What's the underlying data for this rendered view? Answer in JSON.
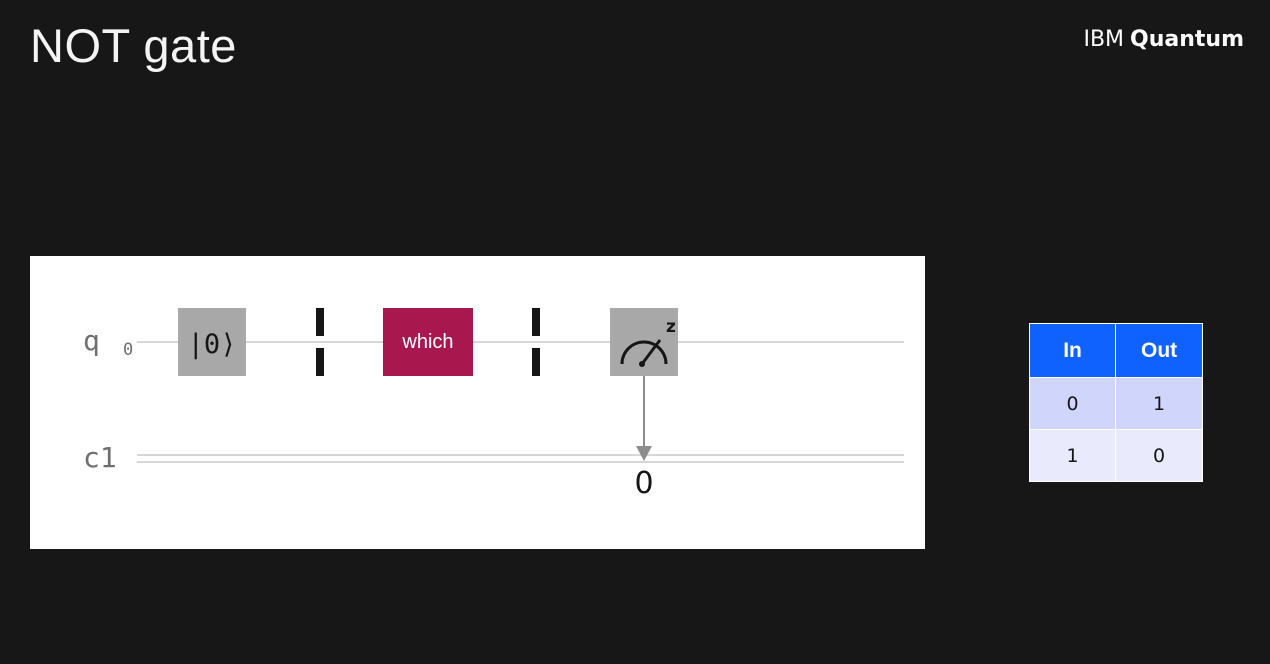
{
  "header": {
    "title": "NOT gate",
    "brand_prefix": "IBM",
    "brand_name": "Quantum"
  },
  "circuit": {
    "qubit_label": "q",
    "qubit_index": "0",
    "classical_label": "c1",
    "reset_gate": "|0⟩",
    "custom_gate": "which",
    "measure_basis": "z",
    "measure_bit": "0",
    "colors": {
      "custom_gate": "#a8184f",
      "grey_gate": "#a8a8a8",
      "barrier": "#161616",
      "wire": "#d6d6d6"
    }
  },
  "truth_table": {
    "headers": [
      "In",
      "Out"
    ],
    "rows": [
      [
        "0",
        "1"
      ],
      [
        "1",
        "0"
      ]
    ],
    "colors": {
      "header": "#0f62fe",
      "row_1": "#d0d6fb",
      "row_2": "#e9ebfc"
    }
  }
}
